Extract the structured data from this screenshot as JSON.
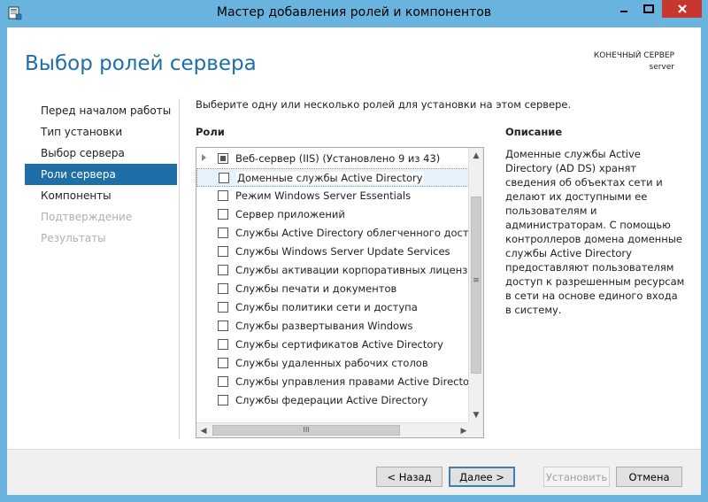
{
  "window": {
    "title": "Мастер добавления ролей и компонентов",
    "controls": {
      "minimize": "‒",
      "maximize": "□",
      "close": "✕"
    }
  },
  "header": {
    "page_title": "Выбор ролей сервера",
    "dest_label": "КОНЕЧНЫЙ СЕРВЕР",
    "dest_server": "server"
  },
  "nav": {
    "items": [
      {
        "label": "Перед началом работы",
        "state": "normal"
      },
      {
        "label": "Тип установки",
        "state": "normal"
      },
      {
        "label": "Выбор сервера",
        "state": "normal"
      },
      {
        "label": "Роли сервера",
        "state": "active"
      },
      {
        "label": "Компоненты",
        "state": "normal"
      },
      {
        "label": "Подтверждение",
        "state": "disabled"
      },
      {
        "label": "Результаты",
        "state": "disabled"
      }
    ]
  },
  "main": {
    "instruction": "Выберите одну или несколько ролей для установки на этом сервере.",
    "roles_header": "Роли",
    "roles": [
      "Веб-сервер (IIS) (Установлено 9 из 43)",
      "Доменные службы Active Directory",
      "Режим Windows Server Essentials",
      "Сервер приложений",
      "Службы Active Directory облегченного доступа к",
      "Службы Windows Server Update Services",
      "Службы активации корпоративных лицензий",
      "Службы печати и документов",
      "Службы политики сети и доступа",
      "Службы развертывания Windows",
      "Службы сертификатов Active Directory",
      "Службы удаленных рабочих столов",
      "Службы управления правами Active Directory",
      "Службы федерации Active Directory"
    ],
    "scroll_glyphs": {
      "up": "▲",
      "down": "▼",
      "left": "◀",
      "right": "▶",
      "grip_v": "≡",
      "grip_h": "III"
    },
    "description_header": "Описание",
    "description": "Доменные службы Active Directory (AD DS) хранят сведения об объектах сети и делают их доступными ее пользователям и администраторам. С помощью контроллеров домена доменные службы Active Directory предоставляют пользователям доступ к разрешенным ресурсам в сети на основе единого входа в систему."
  },
  "footer": {
    "back": "< Назад",
    "next": "Далее >",
    "install": "Установить",
    "cancel": "Отмена"
  },
  "colors": {
    "titlebar": "#69b3df",
    "accent": "#1e6ea8",
    "close": "#c7372f"
  }
}
